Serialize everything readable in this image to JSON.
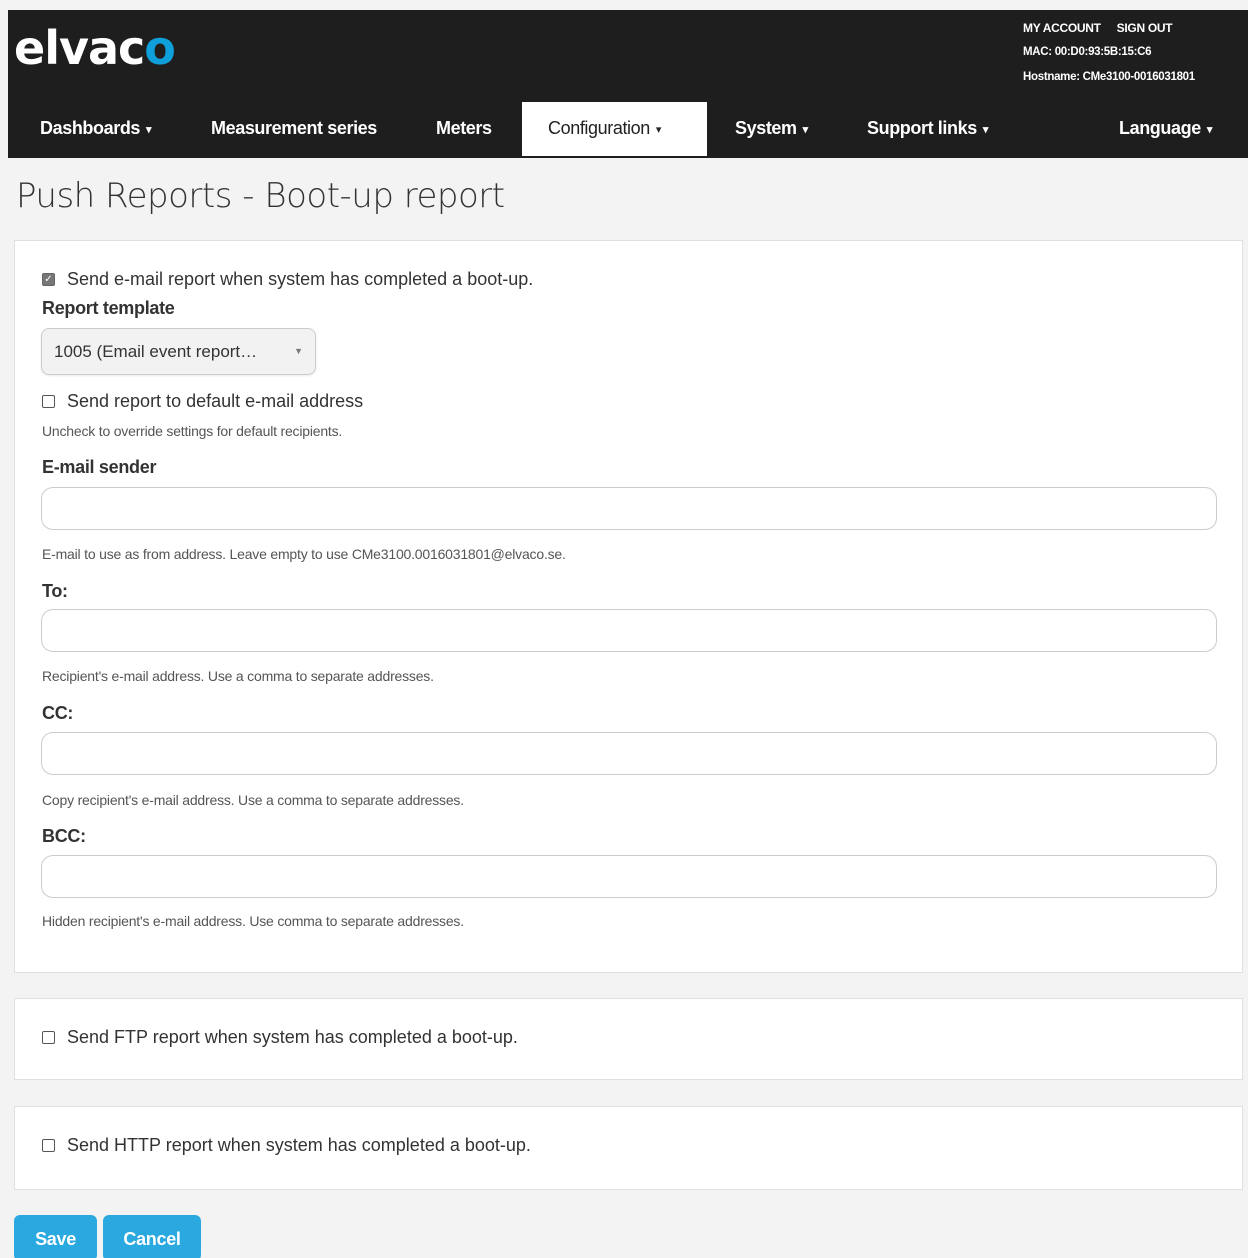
{
  "brand": {
    "logo_text_main": "elvac",
    "logo_text_accent": "o",
    "accent_color": "#0fa0dc"
  },
  "account": {
    "my_account": "MY ACCOUNT",
    "sign_out": "SIGN OUT",
    "mac": "MAC: 00:D0:93:5B:15:C6",
    "hostname": "Hostname: CMe3100-0016031801"
  },
  "nav": {
    "dashboards": "Dashboards",
    "measurement_series": "Measurement series",
    "meters": "Meters",
    "configuration": "Configuration",
    "system": "System",
    "support_links": "Support links",
    "language": "Language",
    "caret": "▾"
  },
  "page": {
    "title": "Push Reports - Boot-up report"
  },
  "email_panel": {
    "send_email_label": "Send e-mail report when system has completed a boot-up.",
    "send_email_checked": true,
    "report_template_label": "Report template",
    "report_template_value": "1005 (Email event report…",
    "default_address_label": "Send report to default e-mail address",
    "default_address_checked": false,
    "default_address_help": "Uncheck to override settings for default recipients.",
    "sender_label": "E-mail sender",
    "sender_value": "",
    "sender_help": "E-mail to use as from address. Leave empty to use CMe3100.0016031801@elvaco.se.",
    "to_label": "To:",
    "to_value": "",
    "to_help": "Recipient's e-mail address. Use a comma to separate addresses.",
    "cc_label": "CC:",
    "cc_value": "",
    "cc_help": "Copy recipient's e-mail address. Use a comma to separate addresses.",
    "bcc_label": "BCC:",
    "bcc_value": "",
    "bcc_help": "Hidden recipient's e-mail address. Use comma to separate addresses."
  },
  "ftp_panel": {
    "label": "Send FTP report when system has completed a boot-up.",
    "checked": false
  },
  "http_panel": {
    "label": "Send HTTP report when system has completed a boot-up.",
    "checked": false
  },
  "actions": {
    "save": "Save",
    "cancel": "Cancel"
  }
}
